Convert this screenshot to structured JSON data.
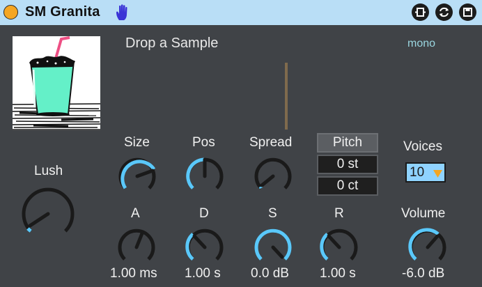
{
  "device": {
    "title": "SM Granita",
    "sample": {
      "drop_label": "Drop a Sample",
      "mode": "mono"
    }
  },
  "colors": {
    "titlebar": "#b9def6",
    "accent": "#5ac8fa",
    "power": "#f5a623",
    "panel": "#404347"
  },
  "knobs": {
    "size": {
      "label": "Size"
    },
    "pos": {
      "label": "Pos"
    },
    "spread": {
      "label": "Spread"
    },
    "lush": {
      "label": "Lush"
    },
    "attack": {
      "label": "A",
      "value": "1.00 ms"
    },
    "decay": {
      "label": "D",
      "value": "1.00 s"
    },
    "sustain": {
      "label": "S",
      "value": "0.0 dB"
    },
    "release": {
      "label": "R",
      "value": "1.00 s"
    },
    "volume": {
      "label": "Volume",
      "value": "-6.0 dB"
    }
  },
  "pitch": {
    "label": "Pitch",
    "semitones": "0 st",
    "cents": "0 ct"
  },
  "voices": {
    "label": "Voices",
    "value": "10"
  }
}
